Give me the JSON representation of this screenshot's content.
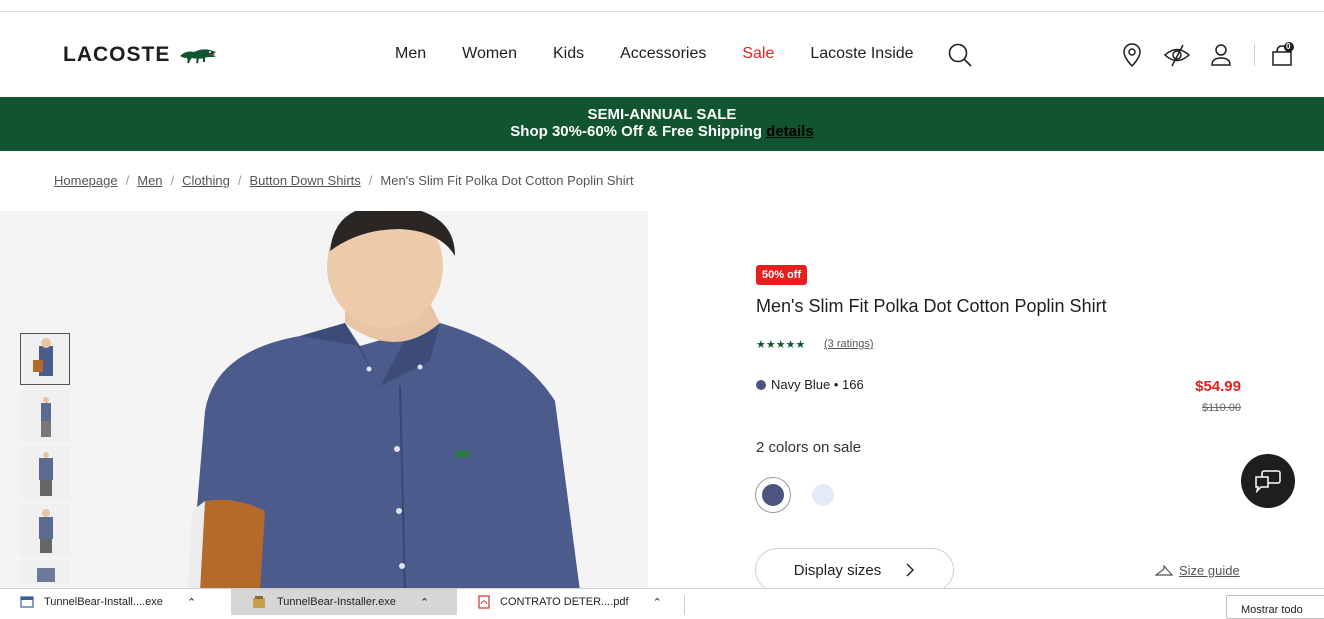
{
  "header": {
    "logo_text": "LACOSTE",
    "nav": [
      "Men",
      "Women",
      "Kids",
      "Accessories",
      "Sale",
      "Lacoste Inside"
    ],
    "cart_count": "0"
  },
  "banner": {
    "line1": "SEMI-ANNUAL SALE",
    "line2": "Shop 30%-60% Off & Free Shipping",
    "link": "details"
  },
  "breadcrumb": [
    "Homepage",
    "Men",
    "Clothing",
    "Button Down Shirts",
    "Men's Slim Fit Polka Dot Cotton Poplin Shirt"
  ],
  "product": {
    "badge": "50% off",
    "title": "Men's Slim Fit Polka Dot Cotton Poplin Shirt",
    "stars": "★★★★★",
    "ratings": "(3 ratings)",
    "color_label": "Navy Blue • 166",
    "price": "$54.99",
    "old_price": "$110.00",
    "colors_on_sale": "2 colors on sale",
    "swatches": [
      "#4a5680",
      "#e4ebf6"
    ],
    "display_sizes": "Display sizes",
    "size_guide": "Size guide"
  },
  "downloads": {
    "items": [
      "TunnelBear-Install....exe",
      "TunnelBear-Installer.exe",
      "CONTRATO DETER....pdf"
    ],
    "show_all": "Mostrar todo"
  },
  "colors": {
    "brand_green": "#115530",
    "sale_red": "#e4211e"
  }
}
